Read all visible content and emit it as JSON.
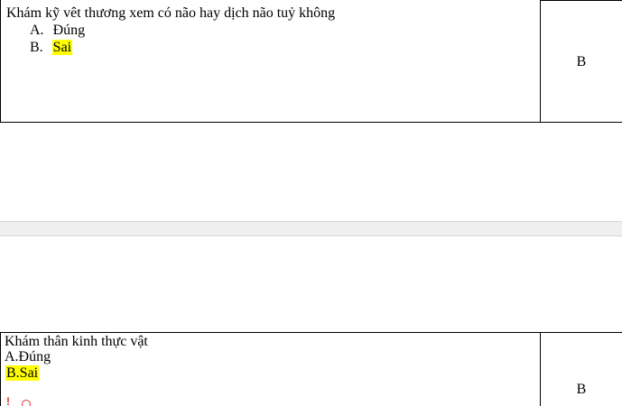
{
  "question1": {
    "text": "Khám kỹ vêt thương xem có não hay dịch não tuỷ không",
    "option_a_letter": "A.",
    "option_a_text": "Đúng",
    "option_b_letter": "B.",
    "option_b_text": "Sai",
    "answer": "B"
  },
  "question2": {
    "text": "Khám thân kinh thực vật",
    "option_a": "A.Đúng",
    "option_b": "B.Sai",
    "answer": "B"
  },
  "colors": {
    "highlight": "#ffff00",
    "page_gap": "#efefef",
    "marker": "#e03030"
  }
}
